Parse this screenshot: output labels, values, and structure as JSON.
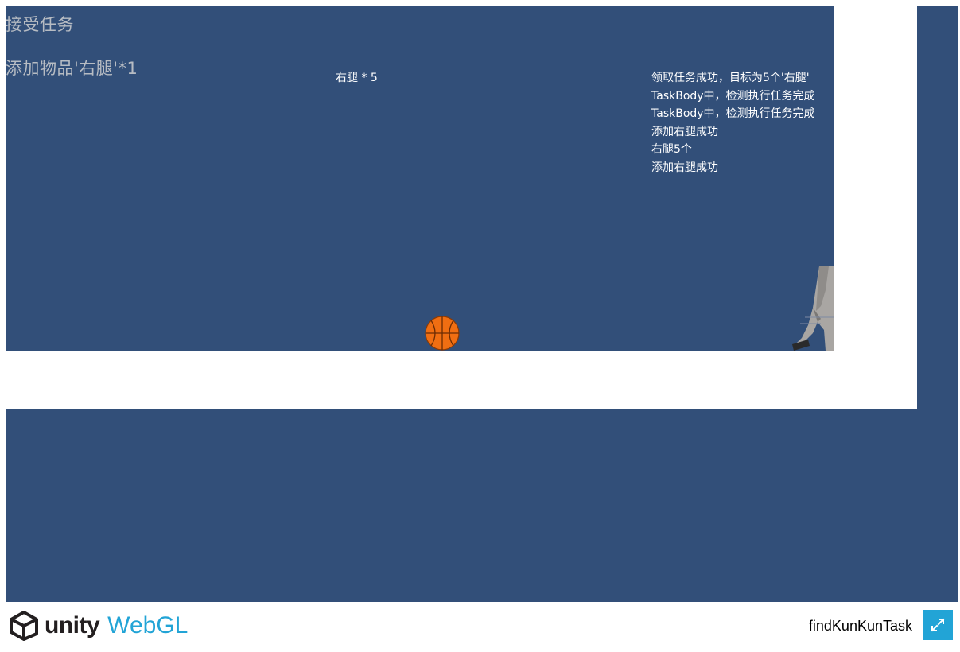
{
  "game": {
    "accept_task": "接受任务",
    "add_item": "添加物品'右腿'*1",
    "inventory": "右腿 * 5",
    "log_lines": [
      "领取任务成功，目标为5个'右腿'",
      "TaskBody中，检测执行任务完成",
      "TaskBody中，检测执行任务完成",
      "添加右腿成功",
      "右腿5个",
      "添加右腿成功"
    ]
  },
  "footer": {
    "logo_text": "unity",
    "webgl_text": "WebGL",
    "build_title": "findKunKunTask"
  },
  "icons": {
    "logo": "unity-cube-icon",
    "fullscreen": "fullscreen-icon"
  },
  "colors": {
    "canvas_background": "#324f79",
    "accent": "#22a4d6"
  }
}
